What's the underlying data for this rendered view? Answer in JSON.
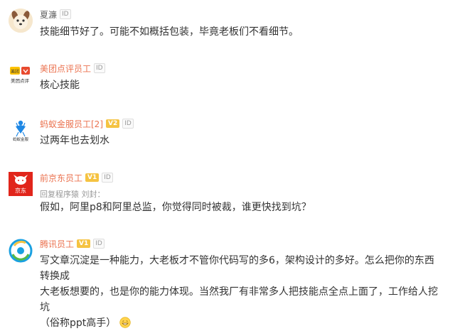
{
  "comments": [
    {
      "user": "夏濂",
      "id_badge": "ID",
      "text": "技能细节好了。可能不如概括包装，毕竟老板们不看细节。",
      "avatar_icon": "dog-face-icon"
    },
    {
      "user": "美团点评员工",
      "id_badge": "ID",
      "text": "核心技能",
      "avatar_icon": "meituan-logo-icon",
      "avatar_texts": [
        "美团",
        "美团点评"
      ]
    },
    {
      "user": "蚂蚁金服员工[2]",
      "v_badge": "V2",
      "id_badge": "ID",
      "text": "过两年也去划水",
      "avatar_icon": "ant-financial-logo-icon",
      "avatar_text": "蚂蚁金服"
    },
    {
      "user": "前京东员工",
      "v_badge": "V1",
      "id_badge": "ID",
      "reply": "回复程序猿 刘封：",
      "text": "假如，阿里p8和阿里总监，你觉得同时被裁，谁更快找到坑？",
      "avatar_icon": "jd-dog-logo-icon",
      "avatar_text": "京东"
    },
    {
      "user": "腾讯员工",
      "v_badge": "V1",
      "id_badge": "ID",
      "text_lines": [
        "写文章沉淀是一种能力，大老板才不管你代码写的多6，架构设计的多好。怎么把你的东西转换成",
        "大老板想要的，也是你的能力体现。当然我厂有非常多人把技能点全点上面了，工作给人挖坑",
        "（俗称ppt高手）"
      ],
      "avatar_icon": "tencent-logo-icon",
      "emoji": "grin-emoji-icon"
    }
  ],
  "colors": {
    "username": "#eb7350",
    "text": "#333333",
    "meta": "#999999",
    "v_badge": "#f5c342"
  }
}
